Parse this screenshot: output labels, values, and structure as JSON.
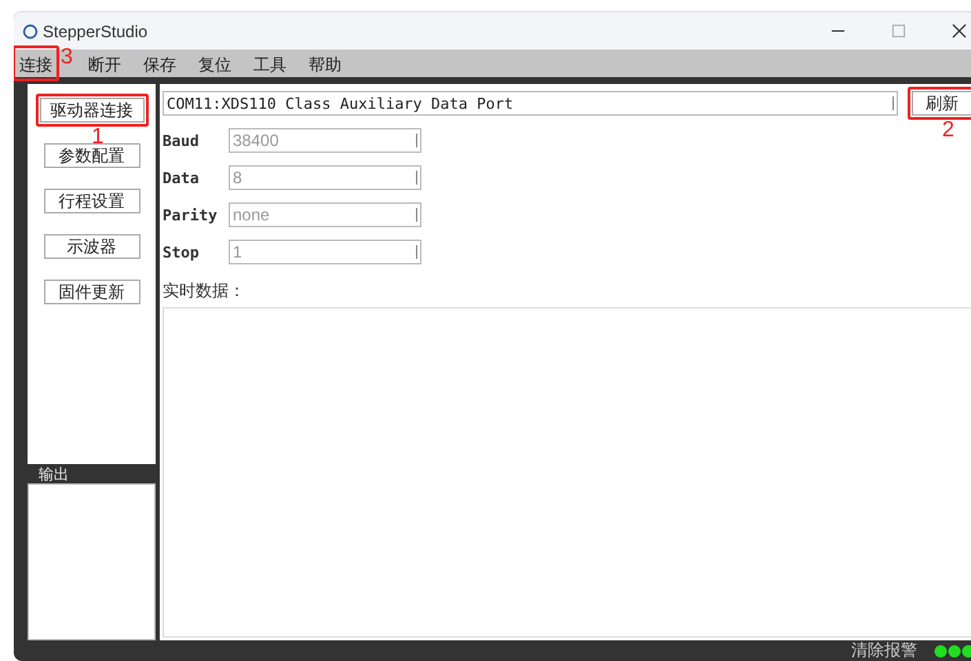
{
  "window": {
    "title": "StepperStudio"
  },
  "menu": [
    {
      "label": "连接",
      "callout": "3"
    },
    {
      "label": "断开"
    },
    {
      "label": "保存"
    },
    {
      "label": "复位"
    },
    {
      "label": "工具"
    },
    {
      "label": "帮助"
    }
  ],
  "sidebar": {
    "buttons": [
      {
        "label": "驱动器连接",
        "callout": "1"
      },
      {
        "label": "参数配置"
      },
      {
        "label": "行程设置"
      },
      {
        "label": "示波器"
      },
      {
        "label": "固件更新"
      }
    ],
    "output_label": "输出"
  },
  "port": {
    "value": "COM11:XDS110 Class Auxiliary Data Port"
  },
  "refresh_button": {
    "label": "刷新",
    "callout": "2"
  },
  "fields": [
    {
      "label": "Baud",
      "value": "38400"
    },
    {
      "label": "Data",
      "value": "8"
    },
    {
      "label": "Parity",
      "value": "none"
    },
    {
      "label": "Stop",
      "value": "1"
    }
  ],
  "realtime_label": "实时数据：",
  "status_bar": {
    "clear_alarm": "清除报警"
  }
}
